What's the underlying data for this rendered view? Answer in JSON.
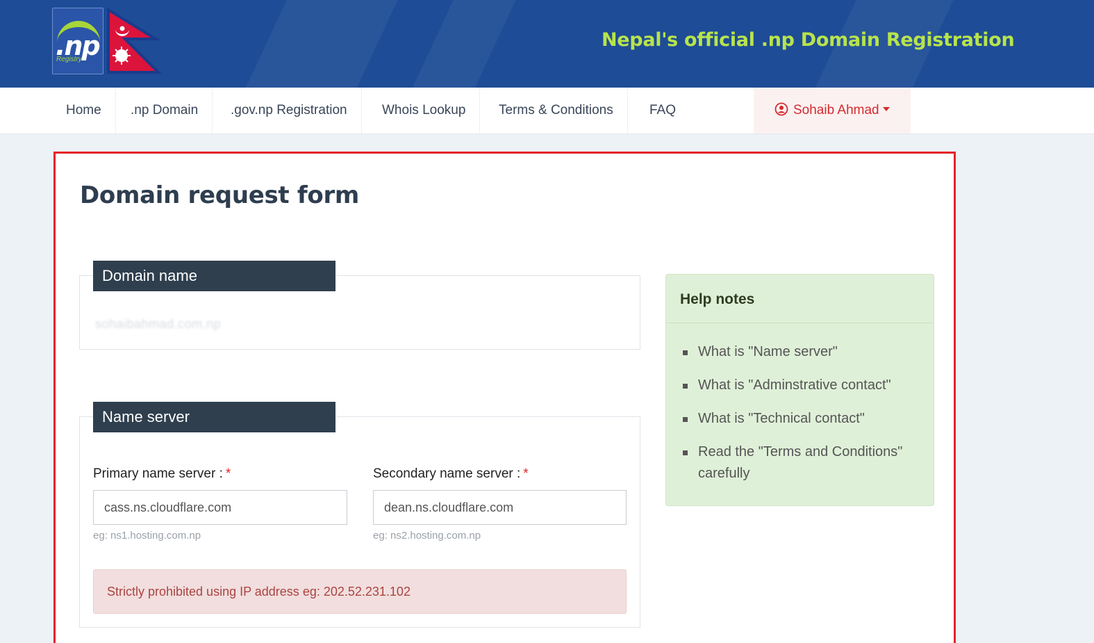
{
  "header": {
    "logo_text": ".np",
    "logo_subtext": "Registry",
    "site_title": "Nepal's official .np Domain Registration"
  },
  "nav": {
    "items": [
      {
        "label": "Home"
      },
      {
        "label": ".np Domain"
      },
      {
        "label": ".gov.np Registration"
      },
      {
        "label": "Whois Lookup"
      },
      {
        "label": "Terms & Conditions"
      },
      {
        "label": "FAQ"
      }
    ],
    "user_name": "Sohaib Ahmad",
    "user_icon": "user-circle-icon",
    "user_caret_icon": "caret-down-icon"
  },
  "form": {
    "title": "Domain request form",
    "domain_section": {
      "legend": "Domain name",
      "value": "sohaibahmad.com.np"
    },
    "nameserver_section": {
      "legend": "Name server",
      "primary": {
        "label": "Primary name server :",
        "required_mark": "*",
        "value": "cass.ns.cloudflare.com",
        "hint": "eg: ns1.hosting.com.np"
      },
      "secondary": {
        "label": "Secondary name server :",
        "required_mark": "*",
        "value": "dean.ns.cloudflare.com",
        "hint": "eg: ns2.hosting.com.np"
      },
      "warning": "Strictly prohibited using IP address eg: 202.52.231.102"
    }
  },
  "help": {
    "title": "Help notes",
    "items": [
      {
        "label": "What is \"Name server\""
      },
      {
        "label": "What is \"Adminstrative contact\""
      },
      {
        "label": "What is \"Technical contact\""
      },
      {
        "label": "Read the \"Terms and Conditions\" carefully"
      }
    ]
  },
  "colors": {
    "banner": "#1e4c96",
    "title_green": "#b8e44c",
    "highlight_border": "#e3232a",
    "legend_bg": "#2f3f4e",
    "help_bg": "#dff0d8",
    "alert_bg": "#f2dede"
  }
}
